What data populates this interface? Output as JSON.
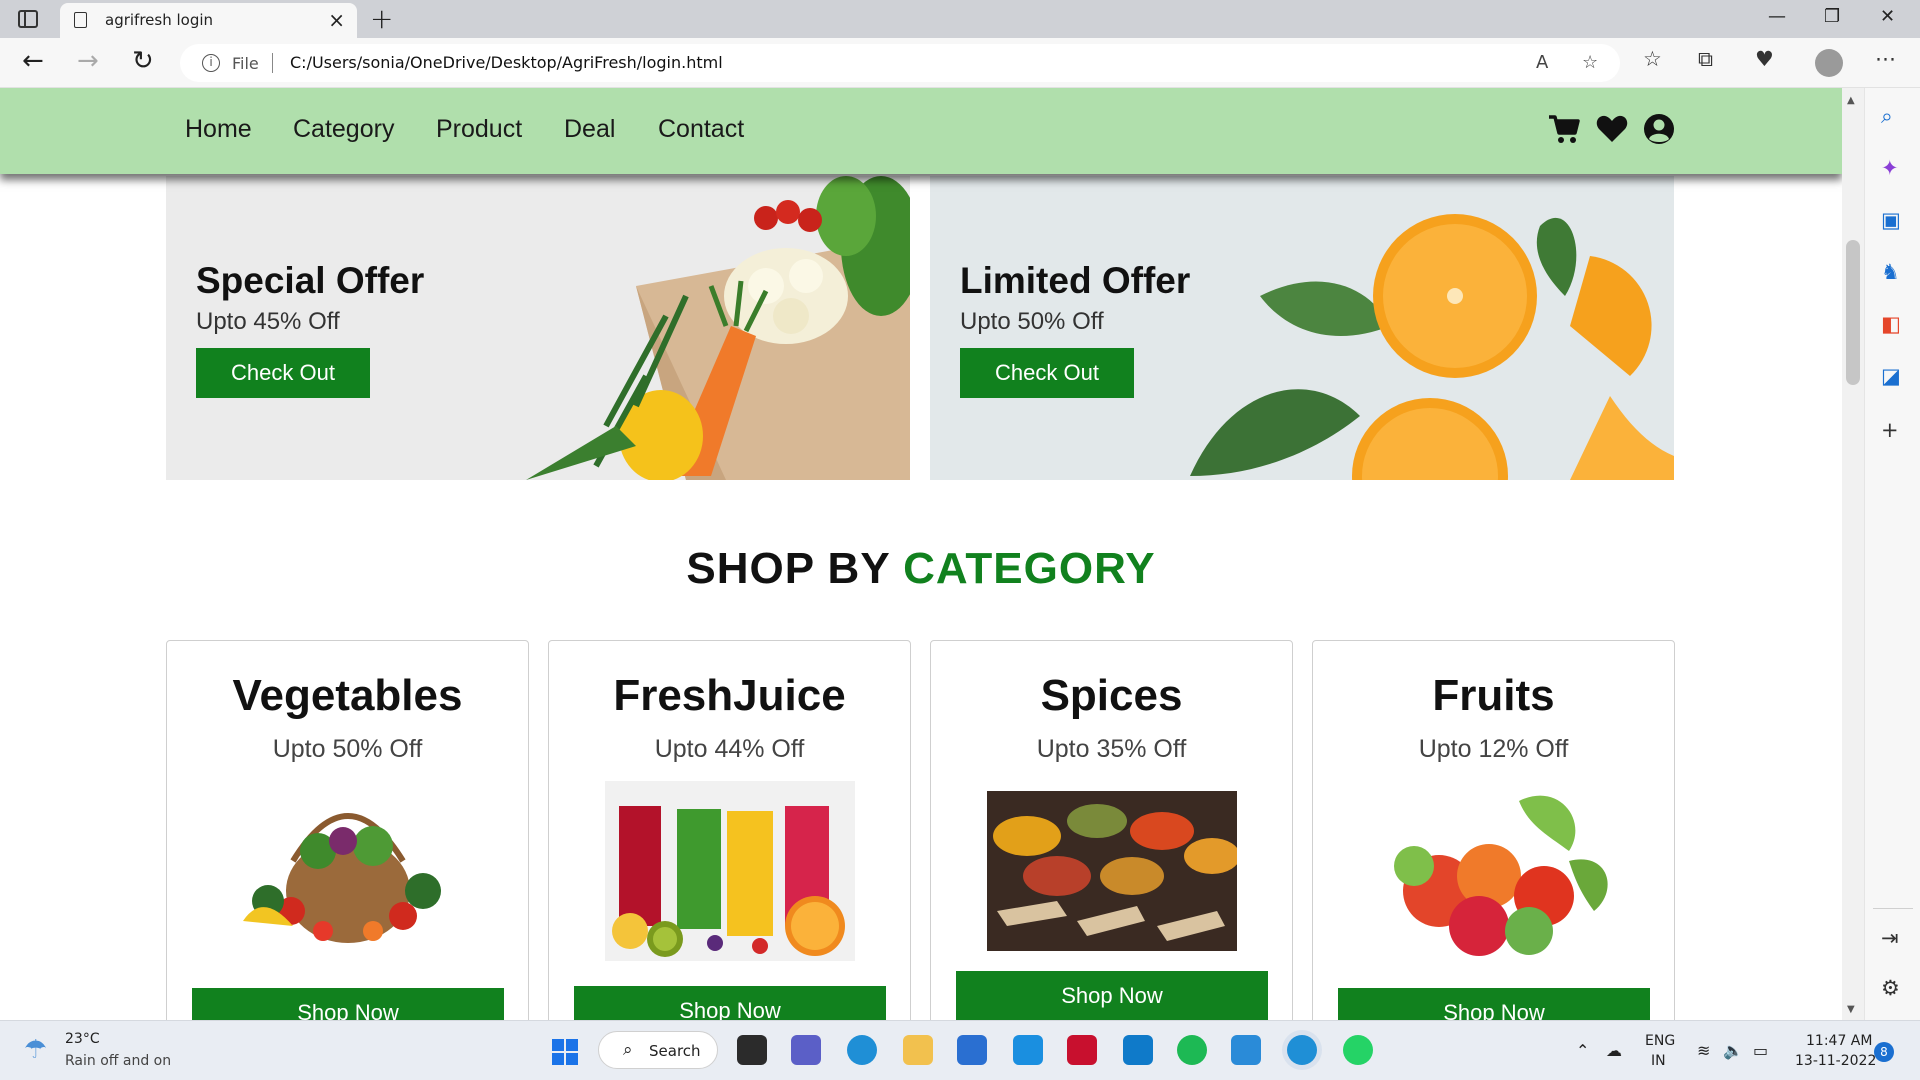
{
  "browser": {
    "tab_title": "agrifresh login",
    "url_scheme_label": "File",
    "url": "C:/Users/sonia/OneDrive/Desktop/AgriFresh/login.html",
    "read_aloud_icon": "read-aloud-icon",
    "favorite_icon": "add-favorite-icon"
  },
  "site": {
    "nav": [
      "Home",
      "Category",
      "Product",
      "Deal",
      "Contact"
    ],
    "header_icons": [
      "cart-icon",
      "heart-icon",
      "user-icon"
    ],
    "offers": [
      {
        "title": "Special Offer",
        "subtitle": "Upto 45% Off",
        "button": "Check Out"
      },
      {
        "title": "Limited Offer",
        "subtitle": "Upto 50% Off",
        "button": "Check Out"
      }
    ],
    "section_title_part1": "SHOP BY",
    "section_title_part2": "CATEGORY",
    "categories": [
      {
        "title": "Vegetables",
        "subtitle": "Upto 50% Off",
        "button": "Shop Now"
      },
      {
        "title": "FreshJuice",
        "subtitle": "Upto 44% Off",
        "button": "Shop Now"
      },
      {
        "title": "Spices",
        "subtitle": "Upto 35% Off",
        "button": "Shop Now"
      },
      {
        "title": "Fruits",
        "subtitle": "Upto 12% Off",
        "button": "Shop Now"
      }
    ],
    "colors": {
      "header_bg": "#b0dfac",
      "accent_green": "#11811e"
    }
  },
  "taskbar": {
    "weather_temp": "23°C",
    "weather_desc": "Rain off and on",
    "search_label": "Search",
    "lang_top": "ENG",
    "lang_bottom": "IN",
    "time": "11:47 AM",
    "date": "13-11-2022",
    "notification_count": "8"
  }
}
